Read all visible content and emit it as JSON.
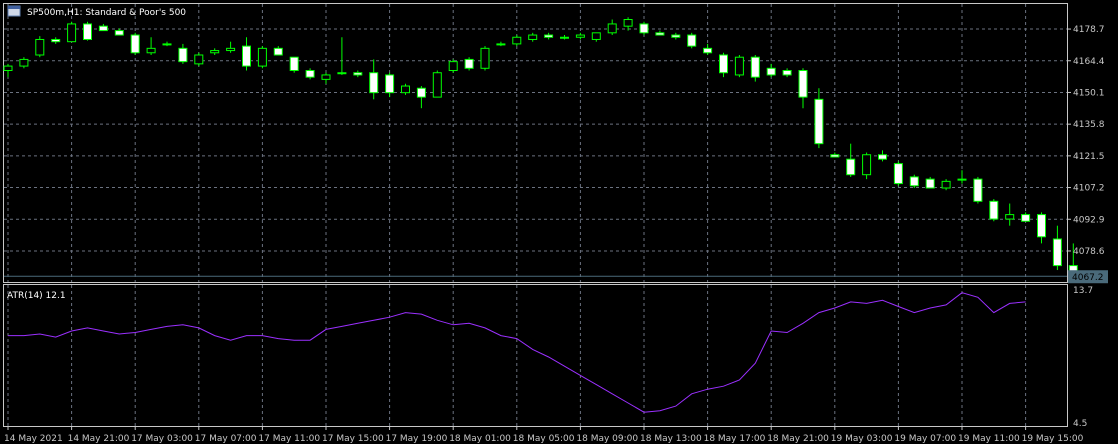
{
  "header": {
    "symbol_line": "SP500m,H1:  Standard & Poor's 500",
    "indicator_line": "ATR(14) 12.1"
  },
  "colors": {
    "background": "#000000",
    "grid": "#6b7280",
    "bull_candle": "#000000",
    "bear_candle": "#ffffff",
    "wick_bull": "#00ff00",
    "wick_bear": "#ffffff",
    "atr_line": "#9b30ff",
    "price_line": "#4a6a7a",
    "axis_text": "#c8c8c8"
  },
  "chart_data": [
    {
      "type": "candlestick",
      "title": "SP500m,H1:  Standard & Poor's 500",
      "ylim": [
        4064.6,
        4190.0
      ],
      "y_ticks": [
        "4178.7",
        "4164.4",
        "4150.1",
        "4135.8",
        "4121.5",
        "4107.2",
        "4092.9",
        "4078.6"
      ],
      "current_price_label": "4067.2",
      "candles": [
        {
          "o": 4160.0,
          "h": 4163.0,
          "l": 4157.0,
          "c": 4162.0
        },
        {
          "o": 4162.0,
          "h": 4166.0,
          "l": 4161.0,
          "c": 4165.0
        },
        {
          "o": 4167.0,
          "h": 4175.5,
          "l": 4166.0,
          "c": 4174.0
        },
        {
          "o": 4174.0,
          "h": 4175.0,
          "l": 4172.0,
          "c": 4173.0
        },
        {
          "o": 4173.0,
          "h": 4182.0,
          "l": 4173.0,
          "c": 4181.0
        },
        {
          "o": 4181.0,
          "h": 4182.0,
          "l": 4173.5,
          "c": 4174.0
        },
        {
          "o": 4180.0,
          "h": 4181.0,
          "l": 4178.0,
          "c": 4178.0
        },
        {
          "o": 4178.0,
          "h": 4179.0,
          "l": 4176.0,
          "c": 4176.0
        },
        {
          "o": 4176.0,
          "h": 4177.0,
          "l": 4167.0,
          "c": 4168.0
        },
        {
          "o": 4168.0,
          "h": 4175.0,
          "l": 4167.0,
          "c": 4170.0
        },
        {
          "o": 4172.0,
          "h": 4173.0,
          "l": 4171.0,
          "c": 4172.0
        },
        {
          "o": 4170.0,
          "h": 4172.0,
          "l": 4163.0,
          "c": 4164.0
        },
        {
          "o": 4163.0,
          "h": 4168.0,
          "l": 4162.0,
          "c": 4167.0
        },
        {
          "o": 4168.0,
          "h": 4170.0,
          "l": 4167.0,
          "c": 4169.0
        },
        {
          "o": 4169.0,
          "h": 4173.0,
          "l": 4168.0,
          "c": 4170.0
        },
        {
          "o": 4171.0,
          "h": 4175.0,
          "l": 4160.0,
          "c": 4162.0
        },
        {
          "o": 4162.0,
          "h": 4171.0,
          "l": 4161.0,
          "c": 4170.0
        },
        {
          "o": 4170.0,
          "h": 4171.0,
          "l": 4167.0,
          "c": 4167.0
        },
        {
          "o": 4166.0,
          "h": 4166.0,
          "l": 4159.0,
          "c": 4160.0
        },
        {
          "o": 4160.0,
          "h": 4161.0,
          "l": 4156.0,
          "c": 4157.0
        },
        {
          "o": 4156.0,
          "h": 4159.0,
          "l": 4154.0,
          "c": 4158.0
        },
        {
          "o": 4159.0,
          "h": 4175.0,
          "l": 4158.0,
          "c": 4159.0
        },
        {
          "o": 4159.0,
          "h": 4160.0,
          "l": 4157.0,
          "c": 4158.0
        },
        {
          "o": 4159.0,
          "h": 4165.0,
          "l": 4147.0,
          "c": 4150.0
        },
        {
          "o": 4158.0,
          "h": 4159.0,
          "l": 4148.0,
          "c": 4150.0
        },
        {
          "o": 4150.0,
          "h": 4154.0,
          "l": 4149.0,
          "c": 4153.0
        },
        {
          "o": 4152.0,
          "h": 4153.0,
          "l": 4143.0,
          "c": 4148.0
        },
        {
          "o": 4148.0,
          "h": 4160.0,
          "l": 4148.0,
          "c": 4159.0
        },
        {
          "o": 4160.0,
          "h": 4165.0,
          "l": 4159.0,
          "c": 4164.0
        },
        {
          "o": 4165.0,
          "h": 4166.0,
          "l": 4160.0,
          "c": 4161.0
        },
        {
          "o": 4161.0,
          "h": 4171.0,
          "l": 4160.0,
          "c": 4170.0
        },
        {
          "o": 4172.0,
          "h": 4173.0,
          "l": 4171.0,
          "c": 4172.0
        },
        {
          "o": 4172.0,
          "h": 4176.0,
          "l": 4171.0,
          "c": 4175.0
        },
        {
          "o": 4174.0,
          "h": 4177.0,
          "l": 4173.0,
          "c": 4176.0
        },
        {
          "o": 4176.0,
          "h": 4177.0,
          "l": 4174.0,
          "c": 4175.0
        },
        {
          "o": 4175.0,
          "h": 4176.0,
          "l": 4174.0,
          "c": 4175.0
        },
        {
          "o": 4175.0,
          "h": 4177.0,
          "l": 4174.0,
          "c": 4176.0
        },
        {
          "o": 4174.0,
          "h": 4177.0,
          "l": 4173.0,
          "c": 4177.0
        },
        {
          "o": 4177.0,
          "h": 4183.0,
          "l": 4176.0,
          "c": 4181.0
        },
        {
          "o": 4180.0,
          "h": 4184.0,
          "l": 4178.0,
          "c": 4183.0
        },
        {
          "o": 4181.0,
          "h": 4182.0,
          "l": 4176.0,
          "c": 4177.0
        },
        {
          "o": 4177.0,
          "h": 4178.0,
          "l": 4176.0,
          "c": 4176.0
        },
        {
          "o": 4176.0,
          "h": 4177.0,
          "l": 4174.0,
          "c": 4175.0
        },
        {
          "o": 4176.0,
          "h": 4177.0,
          "l": 4170.0,
          "c": 4171.0
        },
        {
          "o": 4170.0,
          "h": 4172.0,
          "l": 4167.0,
          "c": 4168.0
        },
        {
          "o": 4167.0,
          "h": 4168.0,
          "l": 4157.0,
          "c": 4159.0
        },
        {
          "o": 4158.0,
          "h": 4167.0,
          "l": 4157.0,
          "c": 4166.0
        },
        {
          "o": 4166.0,
          "h": 4167.0,
          "l": 4155.0,
          "c": 4157.0
        },
        {
          "o": 4161.0,
          "h": 4163.0,
          "l": 4157.0,
          "c": 4158.0
        },
        {
          "o": 4160.0,
          "h": 4161.0,
          "l": 4157.0,
          "c": 4158.0
        },
        {
          "o": 4160.0,
          "h": 4161.0,
          "l": 4143.0,
          "c": 4148.0
        },
        {
          "o": 4147.0,
          "h": 4152.0,
          "l": 4125.0,
          "c": 4127.0
        },
        {
          "o": 4122.0,
          "h": 4123.0,
          "l": 4121.0,
          "c": 4121.0
        },
        {
          "o": 4120.0,
          "h": 4127.0,
          "l": 4112.0,
          "c": 4113.0
        },
        {
          "o": 4113.0,
          "h": 4123.0,
          "l": 4111.0,
          "c": 4122.0
        },
        {
          "o": 4122.0,
          "h": 4124.0,
          "l": 4119.0,
          "c": 4120.0
        },
        {
          "o": 4118.0,
          "h": 4119.0,
          "l": 4108.0,
          "c": 4109.0
        },
        {
          "o": 4112.0,
          "h": 4113.0,
          "l": 4107.0,
          "c": 4108.0
        },
        {
          "o": 4111.0,
          "h": 4112.0,
          "l": 4107.0,
          "c": 4107.0
        },
        {
          "o": 4107.0,
          "h": 4111.0,
          "l": 4106.0,
          "c": 4110.0
        },
        {
          "o": 4111.0,
          "h": 4115.0,
          "l": 4109.0,
          "c": 4111.0
        },
        {
          "o": 4111.0,
          "h": 4112.0,
          "l": 4100.0,
          "c": 4101.0
        },
        {
          "o": 4101.0,
          "h": 4102.0,
          "l": 4092.0,
          "c": 4093.0
        },
        {
          "o": 4093.0,
          "h": 4100.0,
          "l": 4090.0,
          "c": 4095.0
        },
        {
          "o": 4095.0,
          "h": 4096.0,
          "l": 4092.0,
          "c": 4092.0
        },
        {
          "o": 4095.0,
          "h": 4096.0,
          "l": 4082.0,
          "c": 4085.0
        },
        {
          "o": 4084.0,
          "h": 4090.0,
          "l": 4070.0,
          "c": 4072.0
        },
        {
          "o": 4072.0,
          "h": 4082.0,
          "l": 4067.0,
          "c": 4068.0
        }
      ]
    },
    {
      "type": "line",
      "title": "ATR(14) 12.1",
      "ylim": [
        4.5,
        13.7
      ],
      "y_ticks": [
        "13.7",
        "4.5"
      ],
      "x": [
        "14 May 2021",
        "14 May 21:00",
        "17 May 03:00",
        "17 May 07:00",
        "17 May 11:00",
        "17 May 15:00",
        "17 May 19:00",
        "18 May 01:00",
        "18 May 05:00",
        "18 May 09:00",
        "18 May 13:00",
        "18 May 17:00",
        "18 May 21:00",
        "19 May 03:00",
        "19 May 07:00",
        "19 May 11:00",
        "19 May 15:00"
      ],
      "series": [
        {
          "values": [
            10.4,
            10.4,
            10.5,
            10.3,
            10.7,
            10.9,
            10.7,
            10.5,
            10.6,
            10.8,
            11.0,
            11.1,
            10.9,
            10.4,
            10.1,
            10.4,
            10.4,
            10.2,
            10.1,
            10.1,
            10.8,
            11.0,
            11.2,
            11.4,
            11.6,
            11.9,
            11.8,
            11.4,
            11.1,
            11.2,
            10.9,
            10.4,
            10.2,
            9.5,
            9.0,
            8.4,
            7.8,
            7.2,
            6.6,
            6.0,
            5.4,
            5.5,
            5.8,
            6.6,
            6.9,
            7.1,
            7.5,
            8.6,
            10.7,
            10.6,
            11.2,
            11.9,
            12.2,
            12.6,
            12.5,
            12.7,
            12.3,
            11.9,
            12.2,
            12.4,
            13.2,
            12.9,
            11.9,
            12.5,
            12.6
          ]
        }
      ]
    }
  ]
}
